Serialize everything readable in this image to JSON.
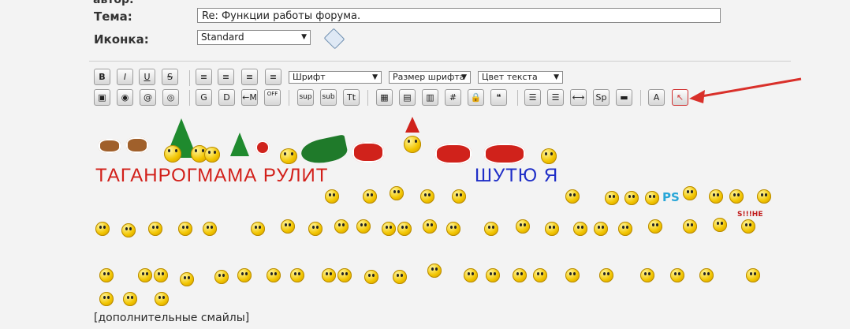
{
  "form": {
    "top_label_cut": "автор:",
    "subject_label": "Тема:",
    "subject_value": "Re: Функции работы форума.",
    "icon_label": "Иконка:",
    "icon_value": "Standard"
  },
  "toolbar": {
    "row1": [
      {
        "name": "bold-button",
        "label": "B"
      },
      {
        "name": "italic-button",
        "label": "I"
      },
      {
        "name": "underline-button",
        "label": "U"
      },
      {
        "name": "strike-button",
        "label": "S"
      },
      {
        "name": "align-left-button",
        "label": "≡"
      },
      {
        "name": "align-justify-left-button",
        "label": "≡"
      },
      {
        "name": "align-center-button",
        "label": "≡"
      },
      {
        "name": "align-right-button",
        "label": "≡"
      }
    ],
    "font_select": "Шрифт",
    "size_select": "Размер шрифта",
    "color_select": "Цвет текста",
    "row2": [
      {
        "name": "image-button",
        "label": "▣"
      },
      {
        "name": "link-button",
        "label": "◉"
      },
      {
        "name": "email-button",
        "label": "@"
      },
      {
        "name": "web-button",
        "label": "◎"
      },
      {
        "name": "glow-button",
        "label": "G"
      },
      {
        "name": "shadow-button",
        "label": "D"
      },
      {
        "name": "marquee-button",
        "label": "←M"
      },
      {
        "name": "offtopic-button",
        "label": "OFF"
      },
      {
        "name": "superscript-button",
        "label": "sup"
      },
      {
        "name": "subscript-button",
        "label": "sub"
      },
      {
        "name": "teletype-button",
        "label": "Tt"
      },
      {
        "name": "table-button",
        "label": "▦"
      },
      {
        "name": "table-row-button",
        "label": "▤"
      },
      {
        "name": "table-column-button",
        "label": "▥"
      },
      {
        "name": "hash-button",
        "label": "#"
      },
      {
        "name": "lock-button",
        "label": "🔒"
      },
      {
        "name": "quote-button",
        "label": "❝"
      },
      {
        "name": "list-button",
        "label": "☰"
      },
      {
        "name": "ordered-list-button",
        "label": "☰"
      },
      {
        "name": "hr-button",
        "label": "⟷"
      },
      {
        "name": "spoiler-button",
        "label": "Sp"
      },
      {
        "name": "media-button",
        "label": "▬"
      },
      {
        "name": "spellcheck-button",
        "label": "A"
      },
      {
        "name": "cursor-button",
        "label": "↖"
      }
    ]
  },
  "smileys": {
    "text_left": "ТАГАНРОГМАМА РУЛИТ",
    "text_right": "ШУТЮ Я",
    "ps_label": "PS",
    "sign_label": "S!!!HE",
    "more_link": "[дополнительные смайлы]"
  },
  "colors": {
    "red_text": "#d2201a",
    "blue_text": "#1f2ec7",
    "arrow": "#d9302a"
  }
}
